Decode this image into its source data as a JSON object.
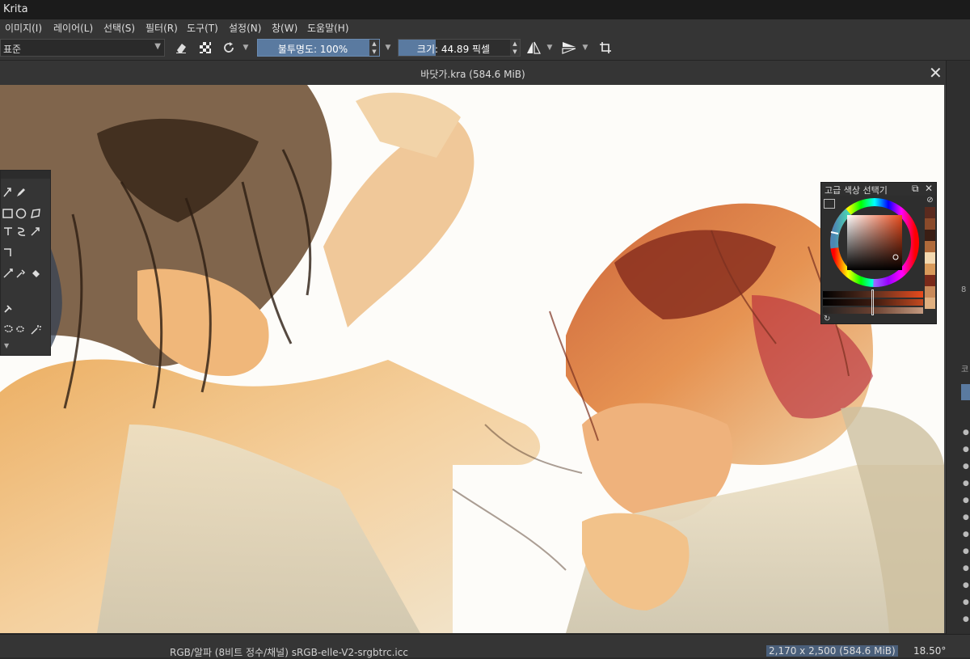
{
  "app_title": "Krita",
  "menu": [
    "이미지(I)",
    "레이어(L)",
    "선택(S)",
    "필터(R)",
    "도구(T)",
    "설정(N)",
    "창(W)",
    "도움말(H)"
  ],
  "toolbar": {
    "preset_label": "표준",
    "opacity_label": "불투명도: 100%",
    "size_label": "크기: 44.89 픽셀",
    "opacity_fraction": 1.0,
    "size_fill_fraction": 0.33
  },
  "document": {
    "title": "바닷가.kra (584.6 MiB)",
    "close_glyph": "✕"
  },
  "color_selector": {
    "title": "고급 색상 선택기",
    "float_glyph": "⧉",
    "close_glyph": "✕"
  },
  "right_strip": {
    "label_a": "8",
    "label_b": "코"
  },
  "status": {
    "color_space": "RGB/알파 (8비트 정수/채널)  sRGB-elle-V2-srgbtrc.icc",
    "dimensions": "2,170 x 2,500 (584.6 MiB)",
    "rotation": "18.50°"
  },
  "colors": {
    "accent_blue": "#5a7aa0",
    "canvas_bg": "#fdfcf9",
    "ui_dark": "#353535"
  }
}
